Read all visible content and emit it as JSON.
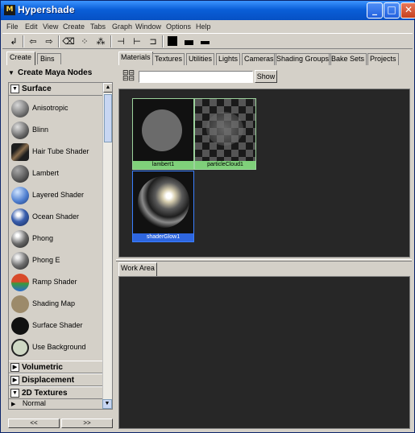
{
  "window": {
    "title": "Hypershade",
    "icon_glyph": "M"
  },
  "menubar": [
    "File",
    "Edit",
    "View",
    "Create",
    "Tabs",
    "Graph",
    "Window",
    "Options",
    "Help"
  ],
  "toolbar": {
    "icons": [
      "corner-arrow-icon",
      "arrow-left-icon",
      "arrow-right-icon",
      "eraser-icon",
      "graph-nodes-icon",
      "graph-network-icon",
      "input-connections-icon",
      "input-output-icon",
      "output-connections-icon",
      "large-swatch-icon",
      "medium-swatch-icon",
      "small-swatch-icon"
    ]
  },
  "left_panel": {
    "tabs": [
      "Create",
      "Bins"
    ],
    "create_header": "Create Maya Nodes",
    "surface_section": "Surface",
    "nodes": [
      {
        "name": "Anisotropic",
        "color": "#7a7a7a"
      },
      {
        "name": "Blinn",
        "color": "#6c6c6c"
      },
      {
        "name": "Hair Tube Shader",
        "color": "#5a4a3a"
      },
      {
        "name": "Lambert",
        "color": "#5c5c5c"
      },
      {
        "name": "Layered Shader",
        "color": "#4f7fd0"
      },
      {
        "name": "Ocean Shader",
        "color": "#3a5fae"
      },
      {
        "name": "Phong",
        "color": "#6a6a6a"
      },
      {
        "name": "Phong E",
        "color": "#707070"
      },
      {
        "name": "Ramp Shader",
        "color": "#d84a2a"
      },
      {
        "name": "Shading Map",
        "color": "#9c8a6a"
      },
      {
        "name": "Surface Shader",
        "color": "#111111"
      },
      {
        "name": "Use Background",
        "color": "#cfd8c4"
      }
    ],
    "collapsed_sections": [
      "Volumetric",
      "Displacement",
      "2D Textures"
    ],
    "sub_item": "Normal",
    "nav_prev": "<<",
    "nav_next": ">>"
  },
  "right_panel": {
    "tabs": [
      "Materials",
      "Textures",
      "Utilities",
      "Lights",
      "Cameras",
      "Shading Groups",
      "Bake Sets",
      "Projects"
    ],
    "active_tab": "Materials",
    "filter_value": "",
    "show_label": "Show",
    "swatches": [
      {
        "label": "lambert1",
        "selected": false
      },
      {
        "label": "particleCloud1",
        "selected": false
      },
      {
        "label": "shaderGlow1",
        "selected": true
      }
    ],
    "workarea_tab": "Work Area"
  }
}
